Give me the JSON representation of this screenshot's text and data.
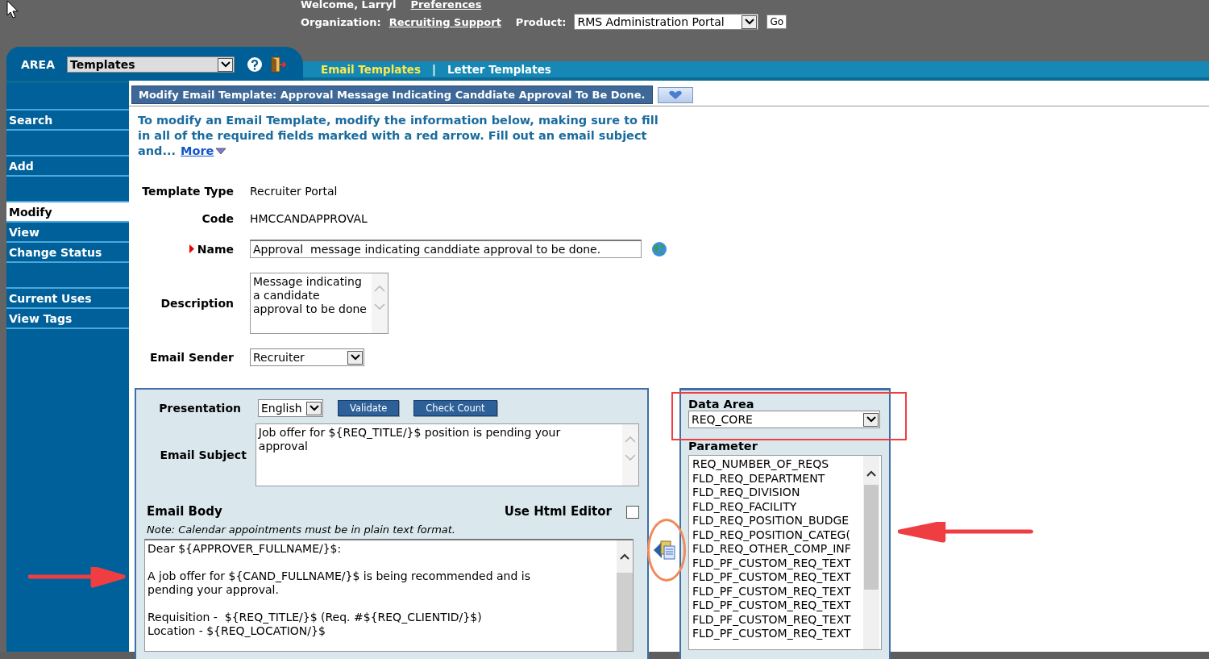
{
  "header": {
    "welcome": "Welcome, Larryl",
    "preferences_link": "Preferences",
    "organization_label": "Organization:",
    "organization_link": "Recruiting Support",
    "product_label": "Product:",
    "product_value": "RMS Administration Portal",
    "go_button": "Go"
  },
  "area": {
    "label": "AREA",
    "value": "Templates"
  },
  "nav_links": [
    {
      "label": "Email Templates",
      "selected": true
    },
    {
      "label": "Letter Templates",
      "selected": false
    }
  ],
  "nav_separator": "|",
  "sidebar": {
    "items": [
      {
        "label": "Search",
        "selected": false,
        "gap_before": true
      },
      {
        "label": "Add",
        "selected": false,
        "gap_before": true
      },
      {
        "label": "Modify",
        "selected": true,
        "gap_before": true
      },
      {
        "label": "View",
        "selected": false,
        "gap_before": false
      },
      {
        "label": "Change Status",
        "selected": false,
        "gap_before": false
      },
      {
        "label": "Current Uses",
        "selected": false,
        "gap_before": true
      },
      {
        "label": "View Tags",
        "selected": false,
        "gap_before": false
      }
    ]
  },
  "page_title": "Modify Email Template: Approval Message Indicating Canddiate Approval To Be Done.",
  "intro": {
    "text": "To modify an Email Template, modify the information below, making sure to fill in all of the required fields marked with a red arrow. Fill out an email subject and...",
    "more_link": "More"
  },
  "form": [
    {
      "label": "Template Type",
      "kind": "text",
      "value": "Recruiter Portal",
      "required": false
    },
    {
      "label": "Code",
      "kind": "text",
      "value": "HMCCANDAPPROVAL",
      "required": false
    },
    {
      "label": "Name",
      "kind": "input",
      "value": "Approval  message indicating canddiate approval to be done.",
      "required": true
    },
    {
      "label": "Description",
      "kind": "textarea",
      "value": "Message indicating a candidate approval to be done",
      "required": false
    },
    {
      "label": "Email Sender",
      "kind": "select",
      "value": "Recruiter",
      "required": false
    }
  ],
  "email": {
    "presentation_label": "Presentation",
    "presentation_value": "English",
    "buttons": [
      "Validate",
      "Check Count"
    ],
    "subject_label": "Email Subject",
    "subject_value": "Job offer for ${REQ_TITLE/}$ position is pending your approval",
    "body_label": "Email Body",
    "html_editor_label": "Use Html Editor",
    "html_editor_checked": false,
    "note": "Note: Calendar appointments must be in plain text format.",
    "body_value": "Dear ${APPROVER_FULLNAME/}$:\n\nA job offer for ${CAND_FULLNAME/}$ is being recommended and is pending your approval.\n\nRequisition -  ${REQ_TITLE/}$ (Req. #${REQ_CLIENTID/}$)\nLocation - ${REQ_LOCATION/}$"
  },
  "data_panel": {
    "data_area_label": "Data Area",
    "data_area_value": "REQ_CORE",
    "parameter_label": "Parameter",
    "parameters": [
      "REQ_NUMBER_OF_REQS",
      "FLD_REQ_DEPARTMENT",
      "FLD_REQ_DIVISION",
      "FLD_REQ_FACILITY",
      "FLD_REQ_POSITION_BUDGE",
      "FLD_REQ_POSITION_CATEG(",
      "FLD_REQ_OTHER_COMP_INF",
      "FLD_PF_CUSTOM_REQ_TEXT",
      "FLD_PF_CUSTOM_REQ_TEXT",
      "FLD_PF_CUSTOM_REQ_TEXT",
      "FLD_PF_CUSTOM_REQ_TEXT",
      "FLD_PF_CUSTOM_REQ_TEXT",
      "FLD_PF_CUSTOM_REQ_TEXT"
    ]
  }
}
